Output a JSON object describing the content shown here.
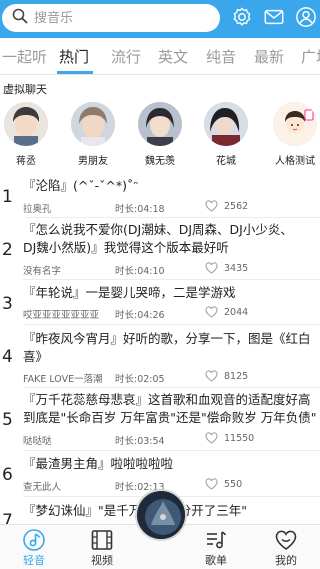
{
  "search": {
    "placeholder": "搜音乐"
  },
  "header_icons": [
    "settings-icon",
    "mail-icon",
    "user-icon"
  ],
  "tabs": [
    {
      "label": "一起听"
    },
    {
      "label": "热门",
      "active": true
    },
    {
      "label": "流行"
    },
    {
      "label": "英文"
    },
    {
      "label": "纯音"
    },
    {
      "label": "最新"
    },
    {
      "label": "广场"
    }
  ],
  "virtual_chat": {
    "title": "虚拟聊天",
    "items": [
      {
        "name": "蒋丞"
      },
      {
        "name": "男朋友"
      },
      {
        "name": "魏无羡"
      },
      {
        "name": "花城"
      },
      {
        "name": "人格测试"
      }
    ]
  },
  "songs": [
    {
      "rank": "1",
      "title_lines": [
        "『沦陷』(^ˇ-ˇ^*)˚ᵔ"
      ],
      "uploader": "拉奥孔",
      "duration": "时长:04:18",
      "likes": "2562"
    },
    {
      "rank": "2",
      "title_lines": [
        "『怎么说我不爱你(DJ潮妹、DJ周森、DJ小少炎、",
        "DJ魏小然版)』我觉得这个版本最好听"
      ],
      "uploader": "没有名字",
      "duration": "时长:04:10",
      "likes": "3435"
    },
    {
      "rank": "3",
      "title_lines": [
        "『年轮说』一是婴儿哭啼，二是学游戏"
      ],
      "uploader": "哎亚亚亚亚亚亚亚",
      "duration": "时长:04:26",
      "likes": "2044"
    },
    {
      "rank": "4",
      "title_lines": [
        "『昨夜风今宵月』好听的歌，分享一下，图是《红白",
        "喜》"
      ],
      "uploader": "FAKE LOVE一落潮",
      "duration": "时长:02:05",
      "likes": "8125"
    },
    {
      "rank": "5",
      "title_lines": [
        "『万千花蕊慈母悲哀』这首歌和血观音的适配度好高",
        "到底是\"长命百岁 万年富贵\"还是\"偿命败岁 万年负债\""
      ],
      "uploader": "哒哒哒",
      "duration": "时长:03:54",
      "likes": "11550"
    },
    {
      "rank": "6",
      "title_lines": [
        "『最渣男主角』啦啦啦啦啦"
      ],
      "uploader": "查无此人",
      "duration": "时长:02:13",
      "likes": "550"
    },
    {
      "rank": "7",
      "title_lines": [
        "『梦幻诛仙』\"是千万年间只分开了三年\""
      ],
      "uploader": "",
      "duration": "",
      "likes": ""
    }
  ],
  "bottom_nav": [
    {
      "label": "轻音",
      "icon": "music-note-icon",
      "active": true
    },
    {
      "label": "视频",
      "icon": "film-icon"
    },
    {
      "label": "歌单",
      "icon": "playlist-icon"
    },
    {
      "label": "我的",
      "icon": "heart-icon"
    }
  ],
  "colors": {
    "accent": "#3aa6ec",
    "text": "#222222",
    "muted": "#9b9b9b"
  }
}
